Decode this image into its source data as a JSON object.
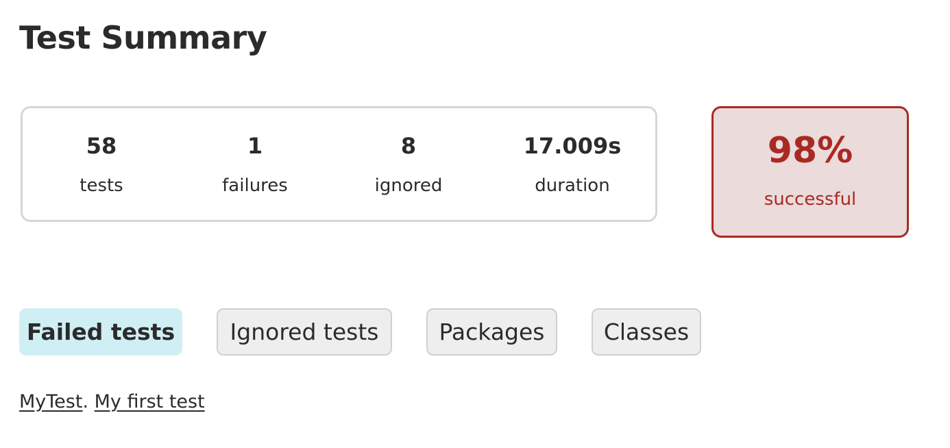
{
  "title": "Test Summary",
  "summary": {
    "tests": {
      "value": "58",
      "label": "tests"
    },
    "failures": {
      "value": "1",
      "label": "failures"
    },
    "ignored": {
      "value": "8",
      "label": "ignored"
    },
    "duration": {
      "value": "17.009s",
      "label": "duration"
    }
  },
  "success_rate": {
    "value": "98%",
    "label": "successful",
    "color": "#a92a23"
  },
  "tabs": [
    {
      "label": "Failed tests",
      "active": true
    },
    {
      "label": "Ignored tests",
      "active": false
    },
    {
      "label": "Packages",
      "active": false
    },
    {
      "label": "Classes",
      "active": false
    }
  ],
  "failed_tests": [
    {
      "class_link": "MyTest",
      "separator": ".",
      "test_link": "My first test"
    }
  ],
  "colors": {
    "active_tab": "#d0eff4",
    "inactive_tab": "#eeeeee",
    "failure": "#a92a23"
  }
}
